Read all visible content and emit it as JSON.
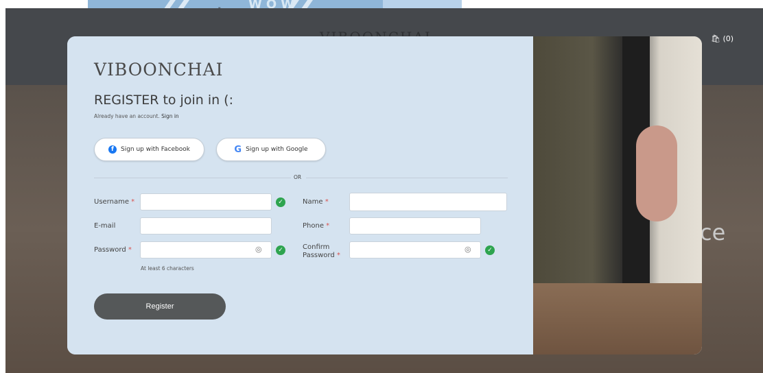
{
  "background": {
    "header_logo": "VIBOONCHAI",
    "cart_label": "(0)",
    "hero_text_fragment": "ce",
    "banner_text": "WOW",
    "banner_glyph": "ู"
  },
  "modal": {
    "brand": "VIBOONCHAI",
    "heading": "REGISTER to join in (:",
    "subtext": "Already have an account.",
    "signin_link": "Sign in",
    "facebook_button": "Sign up with Facebook",
    "google_button": "Sign up with Google",
    "or_label": "OR",
    "fields": {
      "username_label": "Username",
      "name_label": "Name",
      "email_label": "E-mail",
      "phone_label": "Phone",
      "password_label": "Password",
      "confirm_label_line1": "Confirm",
      "confirm_label_line2": "Password",
      "required_mark": "*"
    },
    "password_hint": "At least 6 characters",
    "register_button": "Register"
  },
  "colors": {
    "modal_bg": "#d5e3f0",
    "register_bg": "#555859",
    "check": "#2ea44f",
    "required": "#d9534f"
  }
}
